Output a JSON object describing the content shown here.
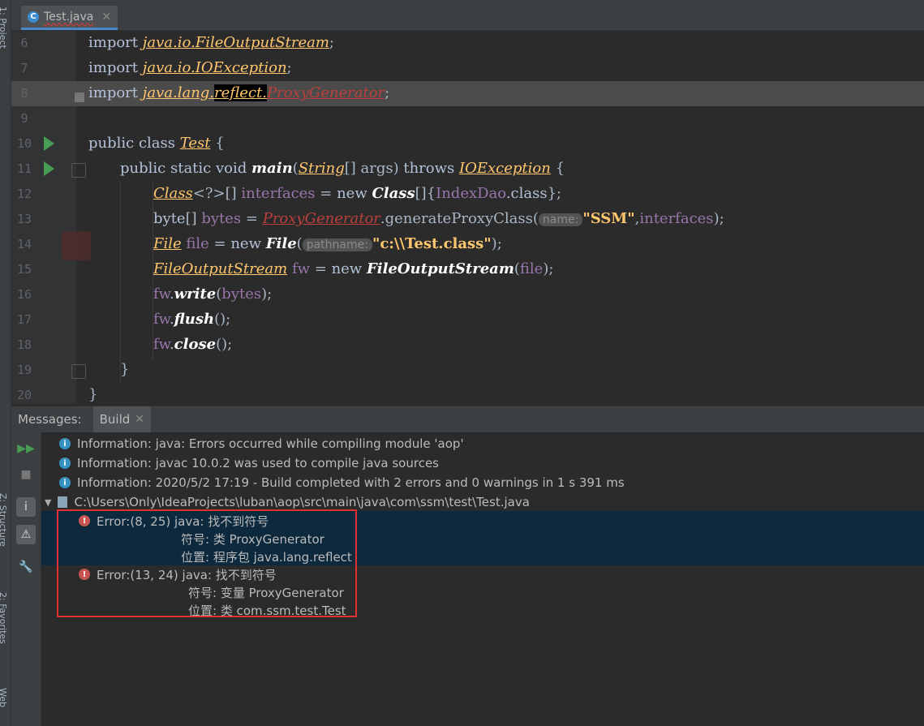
{
  "tab": {
    "label": "Test.java",
    "icon": "class-icon"
  },
  "side_strip": {
    "project": "1: Project",
    "structure": "Z: Structure",
    "favorites": "2: Favorites",
    "web": "Web"
  },
  "editor": {
    "lines": [
      {
        "n": "6"
      },
      {
        "n": "7"
      },
      {
        "n": "8"
      },
      {
        "n": "9"
      },
      {
        "n": "10"
      },
      {
        "n": "11"
      },
      {
        "n": "12"
      },
      {
        "n": "13"
      },
      {
        "n": "14"
      },
      {
        "n": "15"
      },
      {
        "n": "16"
      },
      {
        "n": "17"
      },
      {
        "n": "18"
      },
      {
        "n": "19"
      },
      {
        "n": "20"
      }
    ],
    "tok": {
      "import": "import",
      "java_io": "java.io.",
      "fos": "FileOutputStream",
      "semi": ";",
      "ioe": "IOException",
      "java_lang": "java.lang.",
      "reflect": "reflect.",
      "proxygen": "ProxyGenerator",
      "public": "public",
      "class": "class",
      "Test": "Test",
      "brace_open": "{",
      "static": "static",
      "void": "void",
      "main": "main",
      "paren_open": "(",
      "String": "String",
      "arr_args": "[] args)",
      "throws": "throws",
      "Class": "Class",
      "generic": "<?>[]",
      "interfaces": "interfaces",
      "eq": " = ",
      "new": "new",
      "arr_open": "[]{",
      "IndexDao": "IndexDao",
      "dotclass": ".class",
      "close_semi": "};",
      "byte": "byte",
      "arr": "[]",
      "bytes": "bytes",
      "dot_gen": ".generateProxyClass(",
      "hint_name": "name:",
      "ssm": "\"SSM\"",
      "comma": ",",
      "close_paren_semi": ");",
      "File": "File",
      "file": "file",
      "hint_path": "pathname:",
      "cpath": "\"c:\\\\Test.class\"",
      "fw": "fw",
      "write": "write",
      "flush": "flush",
      "close": "close",
      "dot": ".",
      "lparen": "(",
      "rparen_semi": ");",
      "empty_call": "();",
      "brace_close": "}"
    }
  },
  "panel": {
    "messages_label": "Messages:",
    "build_tab": "Build",
    "info": [
      "Information: java: Errors occurred while compiling module 'aop'",
      "Information: javac 10.0.2 was used to compile java sources",
      "Information: 2020/5/2 17:19 - Build completed with 2 errors and 0 warnings in 1 s 391 ms"
    ],
    "file_path": "C:\\Users\\Only\\IdeaProjects\\luban\\aop\\src\\main\\java\\com\\ssm\\test\\Test.java",
    "errors": [
      {
        "head": "Error:(8, 25)  java: 找不到符号",
        "sym": "符号:  类 ProxyGenerator",
        "loc": "位置: 程序包 java.lang.reflect"
      },
      {
        "head": "Error:(13, 24)  java: 找不到符号",
        "sym": "符号:   变量 ProxyGenerator",
        "loc": "位置: 类 com.ssm.test.Test"
      }
    ]
  }
}
